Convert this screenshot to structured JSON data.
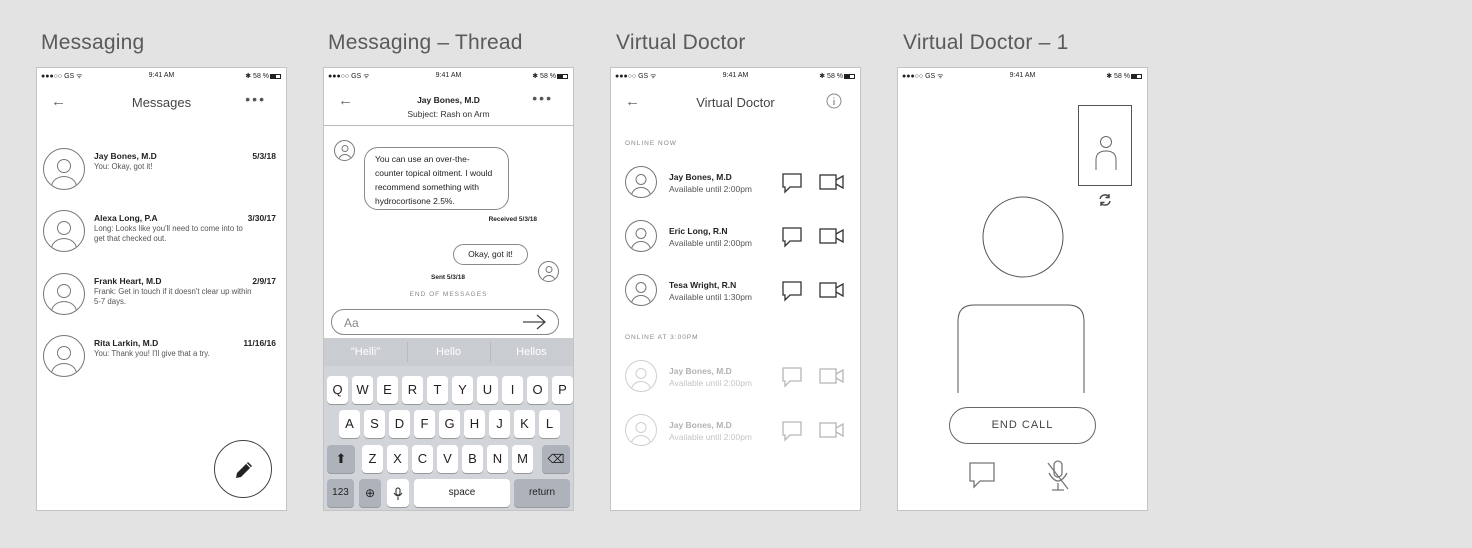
{
  "boards": [
    {
      "title": "Messaging"
    },
    {
      "title": "Messaging – Thread"
    },
    {
      "title": "Virtual Doctor"
    },
    {
      "title": "Virtual Doctor – 1"
    }
  ],
  "status_bar": {
    "carrier": "●●●○○ GS ᯤ",
    "time": "9:41 AM",
    "battery": "✱ 58 %"
  },
  "messaging": {
    "nav_title": "Messages",
    "back_icon": "arrow-left-icon",
    "more_icon": "more-icon",
    "conversations": [
      {
        "name": "Jay Bones, M.D",
        "date": "5/3/18",
        "preview": "You: Okay, got it!"
      },
      {
        "name": "Alexa Long, P.A",
        "date": "3/30/17",
        "preview": "Long: Looks like you'll need to come into to get that checked out."
      },
      {
        "name": "Frank Heart, M.D",
        "date": "2/9/17",
        "preview": "Frank: Get in touch if it doesn't clear up within 5-7 days."
      },
      {
        "name": "Rita Larkin, M.D",
        "date": "11/16/16",
        "preview": "You: Thank you! I'll give that a try."
      }
    ],
    "compose_icon": "pencil-icon"
  },
  "thread": {
    "name": "Jay Bones, M.D",
    "subject": "Subject: Rash on Arm",
    "incoming": "You can use an over-the-counter topical oitment. I would recommend something with hydrocortisone 2.5%.",
    "incoming_meta": "Received 5/3/18",
    "outgoing": "Okay, got it!",
    "outgoing_meta": "Sent 5/3/18",
    "end_label": "END OF MESSAGES",
    "input_placeholder": "Aa",
    "suggestions": [
      "\"Helli\"",
      "Hello",
      "Hellos"
    ],
    "keys_row1": [
      "Q",
      "W",
      "E",
      "R",
      "T",
      "Y",
      "U",
      "I",
      "O",
      "P"
    ],
    "keys_row2": [
      "A",
      "S",
      "D",
      "F",
      "G",
      "H",
      "J",
      "K",
      "L"
    ],
    "keys_row3": [
      "Z",
      "X",
      "C",
      "V",
      "B",
      "N",
      "M"
    ],
    "key_123": "123",
    "key_space": "space",
    "key_return": "return"
  },
  "virtual_doctor": {
    "nav_title": "Virtual Doctor",
    "online_now_label": "ONLINE NOW",
    "online_now": [
      {
        "name": "Jay Bones, M.D",
        "availability": "Available until 2:00pm"
      },
      {
        "name": "Eric Long, R.N",
        "availability": "Available until 2:00pm"
      },
      {
        "name": "Tesa Wright, R.N",
        "availability": "Available until 1:30pm"
      }
    ],
    "online_later_label": "ONLINE AT 3:00PM",
    "online_later": [
      {
        "name": "Jay Bones, M.D",
        "availability": "Available until 2:00pm"
      },
      {
        "name": "Jay Bones, M.D",
        "availability": "Available until 2:00pm"
      }
    ]
  },
  "call": {
    "end_call_label": "END CALL",
    "switch_camera_icon": "refresh-icon",
    "chat_icon": "chat-icon",
    "mute_icon": "mic-off-icon"
  }
}
